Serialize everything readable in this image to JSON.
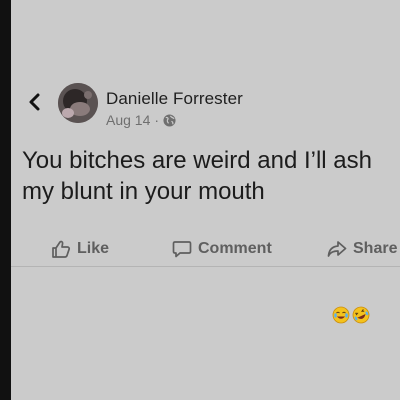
{
  "post": {
    "author_name": "Danielle Forrester",
    "date": "Aug 14",
    "separator": "·",
    "text": "You bitches are weird and I’ll ash my blunt in your mouth"
  },
  "actions": {
    "like_label": "Like",
    "comment_label": "Comment",
    "share_label": "Share"
  },
  "icons": {
    "back": "chevron-left-icon",
    "privacy": "globe-icon",
    "like": "thumbs-up-icon",
    "comment": "speech-bubble-icon",
    "share": "share-arrow-icon",
    "reactions": [
      "crying-laughing-face-emoji",
      "rolling-on-floor-laughing-emoji"
    ]
  },
  "colors": {
    "background": "#cbcbcb",
    "text_primary": "#1c1c1c",
    "text_secondary": "#6f6f6f",
    "left_edge": "#111111"
  }
}
